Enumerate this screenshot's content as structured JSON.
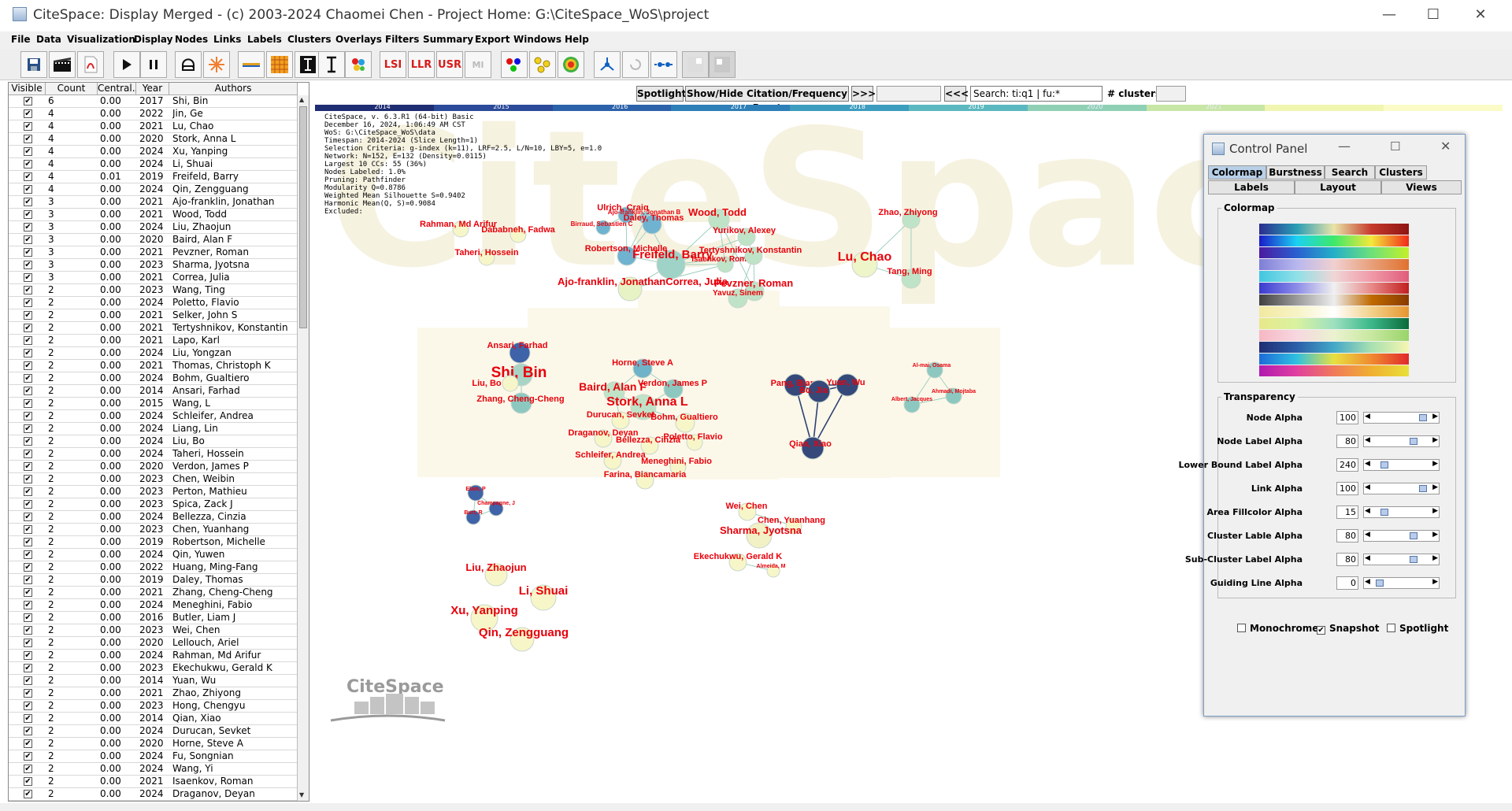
{
  "window": {
    "title": "CiteSpace: Display Merged - (c) 2003-2024 Chaomei Chen - Project Home: G:\\CiteSpace_WoS\\project",
    "minimize": "—",
    "maximize": "☐",
    "close": "✕"
  },
  "menu": [
    "File",
    "Data",
    "Visualization",
    "Display",
    "Nodes",
    "Links",
    "Labels",
    "Clusters",
    "Overlays",
    "Filters",
    "Summary",
    "Export",
    "Windows",
    "Help"
  ],
  "toolbar": {
    "icons": [
      "save-icon",
      "film-icon",
      "pdf-icon",
      "play-icon",
      "pause-icon",
      "refresh-icon",
      "burst-icon",
      "line-icon",
      "grid-icon",
      "text-tool-icon",
      "cursor-tool-icon",
      "palette-icon",
      "lsi-icon",
      "llr-icon",
      "usr-icon",
      "mi-icon",
      "nodes-color-icon",
      "link-color-icon",
      "circle-target-icon",
      "tree-icon",
      "undo-icon",
      "timeline-icon",
      "blank-icon",
      "image-icon"
    ],
    "lsi": "LSI",
    "llr": "LLR",
    "usr": "USR",
    "mi": "MI"
  },
  "table": {
    "headers": [
      "Visible",
      "Count",
      "Central...",
      "Year",
      "Authors"
    ],
    "rows": [
      [
        "6",
        "0.00",
        "2017",
        "Shi, Bin"
      ],
      [
        "4",
        "0.00",
        "2022",
        "Jin, Ge"
      ],
      [
        "4",
        "0.00",
        "2021",
        "Lu, Chao"
      ],
      [
        "4",
        "0.00",
        "2020",
        "Stork, Anna L"
      ],
      [
        "4",
        "0.00",
        "2024",
        "Xu, Yanping"
      ],
      [
        "4",
        "0.00",
        "2024",
        "Li, Shuai"
      ],
      [
        "4",
        "0.01",
        "2019",
        "Freifeld, Barry"
      ],
      [
        "4",
        "0.00",
        "2024",
        "Qin, Zengguang"
      ],
      [
        "3",
        "0.00",
        "2021",
        "Ajo-franklin, Jonathan"
      ],
      [
        "3",
        "0.00",
        "2021",
        "Wood, Todd"
      ],
      [
        "3",
        "0.00",
        "2024",
        "Liu, Zhaojun"
      ],
      [
        "3",
        "0.00",
        "2020",
        "Baird, Alan F"
      ],
      [
        "3",
        "0.00",
        "2021",
        "Pevzner, Roman"
      ],
      [
        "3",
        "0.00",
        "2023",
        "Sharma, Jyotsna"
      ],
      [
        "3",
        "0.00",
        "2021",
        "Correa, Julia"
      ],
      [
        "2",
        "0.00",
        "2023",
        "Wang, Ting"
      ],
      [
        "2",
        "0.00",
        "2024",
        "Poletto, Flavio"
      ],
      [
        "2",
        "0.00",
        "2021",
        "Selker, John S"
      ],
      [
        "2",
        "0.00",
        "2021",
        "Tertyshnikov, Konstantin"
      ],
      [
        "2",
        "0.00",
        "2021",
        "Lapo, Karl"
      ],
      [
        "2",
        "0.00",
        "2024",
        "Liu, Yongzan"
      ],
      [
        "2",
        "0.00",
        "2021",
        "Thomas, Christoph K"
      ],
      [
        "2",
        "0.00",
        "2024",
        "Bohm, Gualtiero"
      ],
      [
        "2",
        "0.00",
        "2014",
        "Ansari, Farhad"
      ],
      [
        "2",
        "0.00",
        "2015",
        "Wang, L"
      ],
      [
        "2",
        "0.00",
        "2024",
        "Schleifer, Andrea"
      ],
      [
        "2",
        "0.00",
        "2024",
        "Liang, Lin"
      ],
      [
        "2",
        "0.00",
        "2024",
        "Liu, Bo"
      ],
      [
        "2",
        "0.00",
        "2024",
        "Taheri, Hossein"
      ],
      [
        "2",
        "0.00",
        "2020",
        "Verdon, James P"
      ],
      [
        "2",
        "0.00",
        "2023",
        "Chen, Weibin"
      ],
      [
        "2",
        "0.00",
        "2023",
        "Perton, Mathieu"
      ],
      [
        "2",
        "0.00",
        "2023",
        "Spica, Zack J"
      ],
      [
        "2",
        "0.00",
        "2024",
        "Bellezza, Cinzia"
      ],
      [
        "2",
        "0.00",
        "2023",
        "Chen, Yuanhang"
      ],
      [
        "2",
        "0.00",
        "2019",
        "Robertson, Michelle"
      ],
      [
        "2",
        "0.00",
        "2024",
        "Qin, Yuwen"
      ],
      [
        "2",
        "0.00",
        "2022",
        "Huang, Ming-Fang"
      ],
      [
        "2",
        "0.00",
        "2019",
        "Daley, Thomas"
      ],
      [
        "2",
        "0.00",
        "2021",
        "Zhang, Cheng-Cheng"
      ],
      [
        "2",
        "0.00",
        "2024",
        "Meneghini, Fabio"
      ],
      [
        "2",
        "0.00",
        "2016",
        "Butler, Liam J"
      ],
      [
        "2",
        "0.00",
        "2023",
        "Wei, Chen"
      ],
      [
        "2",
        "0.00",
        "2020",
        "Lellouch, Ariel"
      ],
      [
        "2",
        "0.00",
        "2024",
        "Rahman, Md Arifur"
      ],
      [
        "2",
        "0.00",
        "2023",
        "Ekechukwu, Gerald K"
      ],
      [
        "2",
        "0.00",
        "2014",
        "Yuan, Wu"
      ],
      [
        "2",
        "0.00",
        "2021",
        "Zhao, Zhiyong"
      ],
      [
        "2",
        "0.00",
        "2023",
        "Hong, Chengyu"
      ],
      [
        "2",
        "0.00",
        "2014",
        "Qian, Xiao"
      ],
      [
        "2",
        "0.00",
        "2024",
        "Durucan, Sevket"
      ],
      [
        "2",
        "0.00",
        "2020",
        "Horne, Steve A"
      ],
      [
        "2",
        "0.00",
        "2024",
        "Fu, Songnian"
      ],
      [
        "2",
        "0.00",
        "2024",
        "Wang, Yi"
      ],
      [
        "2",
        "0.00",
        "2021",
        "Isaenkov, Roman"
      ],
      [
        "2",
        "0.00",
        "2024",
        "Draganov, Deyan"
      ]
    ]
  },
  "netbar": {
    "spotlight": "Spotlight",
    "burst": "Show/Hide Citation/Frequency Burst",
    "next": ">>>",
    "prev": "<<<",
    "search": "Search: ti:q1 | fu:*",
    "clusters_label": "# clusters"
  },
  "timeline": {
    "years": [
      "2014",
      "2015",
      "2016",
      "2017",
      "2018",
      "2019",
      "2020",
      "2021"
    ],
    "colors": [
      "#1f2d73",
      "#2b4a9a",
      "#2c62aa",
      "#2e7fb8",
      "#3c9dbf",
      "#5bb8c0",
      "#8fd0b5",
      "#c8e6a5",
      "#f0f6b0",
      "#fbfbc8"
    ]
  },
  "info": [
    "CiteSpace, v. 6.3.R1 (64-bit) Basic",
    "December 16, 2024, 1:06:49 AM CST",
    "WoS: G:\\CiteSpace_WoS\\data",
    "Timespan: 2014-2024 (Slice Length=1)",
    "Selection Criteria: g-index (k=11), LRF=2.5, L/N=10, LBY=5, e=1.0",
    "Network: N=152, E=132 (Density=0.0115)",
    "Largest 10 CCs: 55 (36%)",
    "Nodes Labeled: 1.0%",
    "Pruning: Pathfinder",
    "Modularity Q=0.8786",
    "Weighted Mean Silhouette S=0.9402",
    "Harmonic Mean(Q, S)=0.9084",
    "Excluded:"
  ],
  "watermark": "CiteSpace",
  "logo": "CiteSpace",
  "network": {
    "label_color": "#e8000b",
    "nodes": [
      {
        "label": "Rahman, Md Arifur",
        "fs": 11,
        "nc": "#f7f6c9"
      },
      {
        "label": "Dababneh, Fadwa",
        "fs": 11,
        "nc": "#f7f6c9"
      },
      {
        "label": "Taheri, Hossein",
        "fs": 11,
        "nc": "#f7f6c9"
      },
      {
        "label": "Ulrich, Craig",
        "fs": 11,
        "nc": "#6fb3d0"
      },
      {
        "label": "Ajo-franklin, Jonathan B",
        "fs": 8,
        "nc": "#8cc8d6"
      },
      {
        "label": "Daley, Thomas",
        "fs": 11,
        "nc": "#6fb3d0"
      },
      {
        "label": "Birraud, Sebastien C",
        "fs": 8,
        "nc": "#6fb3d0"
      },
      {
        "label": "Wood, Todd",
        "fs": 13,
        "nc": "#bfe3c6"
      },
      {
        "label": "Yurikov, Alexey",
        "fs": 11,
        "nc": "#bfe3c6"
      },
      {
        "label": "Robertson, Michelle",
        "fs": 11,
        "nc": "#6fb3d0"
      },
      {
        "label": "Freifeld, Barry",
        "fs": 15,
        "nc": "#9fd3c7"
      },
      {
        "label": "Isaenkov, Roman",
        "fs": 10,
        "nc": "#bfe3c6"
      },
      {
        "label": "Tertyshnikov, Konstantin",
        "fs": 11,
        "nc": "#bfe3c6"
      },
      {
        "label": "Ajo-franklin, JonathanCorrea, Julia",
        "fs": 13,
        "nc": "#e8f3c5"
      },
      {
        "label": "Pevzner, Roman",
        "fs": 13,
        "nc": "#bfe3c6"
      },
      {
        "label": "Yavuz, Sinem",
        "fs": 10,
        "nc": "#bfe3c6"
      },
      {
        "label": "Zhao, Zhiyong",
        "fs": 11,
        "nc": "#bfe3c6"
      },
      {
        "label": "Lu, Chao",
        "fs": 16,
        "nc": "#eef5c8"
      },
      {
        "label": "Tang, Ming",
        "fs": 11,
        "nc": "#bfe3c6"
      },
      {
        "label": "Ansari, Farhad",
        "fs": 11,
        "nc": "#3f63a8"
      },
      {
        "label": "Shi, Bin",
        "fs": 19,
        "nc": "#a8d4c6"
      },
      {
        "label": "Liu, Bo",
        "fs": 11,
        "nc": "#f7f6c9"
      },
      {
        "label": "Zhang, Cheng-Cheng",
        "fs": 11,
        "nc": "#8cc8c0"
      },
      {
        "label": "Horne, Steve A",
        "fs": 11,
        "nc": "#6fb3c8"
      },
      {
        "label": "Baird, Alan F",
        "fs": 14,
        "nc": "#bfe3c6"
      },
      {
        "label": "Verdon, James P",
        "fs": 11,
        "nc": "#8cc8c0"
      },
      {
        "label": "Stork, Anna L",
        "fs": 16,
        "nc": "#bfe3c6"
      },
      {
        "label": "Durucan, Sevket",
        "fs": 11,
        "nc": "#f7f6c9"
      },
      {
        "label": "Bohm, Gualtiero",
        "fs": 11,
        "nc": "#f7f6c9"
      },
      {
        "label": "Draganov, Deyan",
        "fs": 11,
        "nc": "#f7f6c9"
      },
      {
        "label": "Bellezza, Cinzia",
        "fs": 11,
        "nc": "#f7f6c9"
      },
      {
        "label": "Poletto, Flavio",
        "fs": 11,
        "nc": "#f7f6c9"
      },
      {
        "label": "Schleifer, Andrea",
        "fs": 11,
        "nc": "#f7f6c9"
      },
      {
        "label": "Meneghini, Fabio",
        "fs": 11,
        "nc": "#f7f6c9"
      },
      {
        "label": "Farina, Biancamaria",
        "fs": 11,
        "nc": "#f7f6c9"
      },
      {
        "label": "Pang, Bian",
        "fs": 11,
        "nc": "#34497a"
      },
      {
        "label": "Bo, Jia",
        "fs": 11,
        "nc": "#34497a"
      },
      {
        "label": "Yuan, Wu",
        "fs": 11,
        "nc": "#34497a"
      },
      {
        "label": "Qian, Xiao",
        "fs": 11,
        "nc": "#34497a"
      },
      {
        "label": "Al-mai, Osama",
        "fs": 7,
        "nc": "#8cc8c0"
      },
      {
        "label": "Ahmadi, Mojtaba",
        "fs": 7,
        "nc": "#8cc8c0"
      },
      {
        "label": "Albert, Jacques",
        "fs": 7,
        "nc": "#8cc8c0"
      },
      {
        "label": "Elam, P",
        "fs": 7,
        "nc": "#3f63a8"
      },
      {
        "label": "Champagne, J",
        "fs": 7,
        "nc": "#3f63a8"
      },
      {
        "label": "Burt, R",
        "fs": 7,
        "nc": "#3f63a8"
      },
      {
        "label": "Wei, Chen",
        "fs": 11,
        "nc": "#f7f6c9"
      },
      {
        "label": "Chen, Yuanhang",
        "fs": 11,
        "nc": "#f7f6c9"
      },
      {
        "label": "Sharma, Jyotsna",
        "fs": 13,
        "nc": "#f2f1c6"
      },
      {
        "label": "Ekechukwu, Gerald K",
        "fs": 11,
        "nc": "#f7f6c9"
      },
      {
        "label": "Almeida, M",
        "fs": 7,
        "nc": "#f7f6c9"
      },
      {
        "label": "Liu, Zhaojun",
        "fs": 13,
        "nc": "#f7f6c9"
      },
      {
        "label": "Li, Shuai",
        "fs": 15,
        "nc": "#f7f6c9"
      },
      {
        "label": "Xu, Yanping",
        "fs": 15,
        "nc": "#f7f6c9"
      },
      {
        "label": "Qin, Zengguang",
        "fs": 15,
        "nc": "#f7f6c9"
      }
    ]
  },
  "control_panel": {
    "title": "Control Panel",
    "tabs_row1": [
      "Colormap",
      "Burstness",
      "Search",
      "Clusters"
    ],
    "tabs_row2": [
      "Labels",
      "Layout",
      "Views"
    ],
    "colormap_title": "Colormap",
    "transparency_title": "Transparency",
    "gradients": [
      "linear-gradient(90deg,#2b2d8f,#2a9db5,#e9e3a8,#c63a2c,#8e1414)",
      "linear-gradient(90deg,#1b1bc8,#1bd1f2,#3de86a,#f5e83a,#f22a1a)",
      "linear-gradient(90deg,#4b1aa0,#2a5fd0,#24b0c8,#6de07a,#c3f028)",
      "linear-gradient(90deg,#7e7ed8,#b7b7ee,#f0d0d0,#e8a07a,#e0722f)",
      "linear-gradient(90deg,#41c6e0,#8fe0e8,#f0d6d6,#f09aa8,#e05c7a)",
      "linear-gradient(90deg,#3a3ad0,#8c8ce8,#f0f0f0,#e88a8a,#c21f1f)",
      "linear-gradient(90deg,#404040,#9a9a9a,#ededed,#c06a00,#8a3a00)",
      "linear-gradient(90deg,#f2e9a0,#f7f3c5,#ffffff,#f2d18a,#e89630)",
      "linear-gradient(90deg,#e8e88a,#d9f2a0,#9de0c0,#3bb88a,#0b6a3a)",
      "linear-gradient(90deg,#f6b7c3,#f7d7e0,#eaf2d0,#c8e8a0,#9ad46a)",
      "linear-gradient(90deg,#1f2d73,#2b5ea8,#44a8c8,#a8e0b0,#f6f6b0)",
      "linear-gradient(90deg,#1d6bd8,#2fc0e0,#e8e040,#f08a30,#e02a2a)",
      "linear-gradient(90deg,#b01ab0,#e040a0,#f07a5a,#f0b030,#e8e03a)"
    ],
    "sliders": [
      {
        "label": "Node Alpha",
        "value": "100",
        "pos": 0.88
      },
      {
        "label": "Node Label Alpha",
        "value": "80",
        "pos": 0.7
      },
      {
        "label": "Lower Bound Label Alpha",
        "value": "240",
        "pos": 0.14
      },
      {
        "label": "Link Alpha",
        "value": "100",
        "pos": 0.88
      },
      {
        "label": "Area Fillcolor Alpha",
        "value": "15",
        "pos": 0.14
      },
      {
        "label": "Cluster Lable Alpha",
        "value": "80",
        "pos": 0.7
      },
      {
        "label": "Sub-Cluster Label Alpha",
        "value": "80",
        "pos": 0.7
      },
      {
        "label": "Guiding Line Alpha",
        "value": "0",
        "pos": 0.05
      }
    ],
    "checkboxes": [
      {
        "label": "Monochrome",
        "checked": false
      },
      {
        "label": "Snapshot",
        "checked": true
      },
      {
        "label": "Spotlight",
        "checked": false
      }
    ]
  }
}
